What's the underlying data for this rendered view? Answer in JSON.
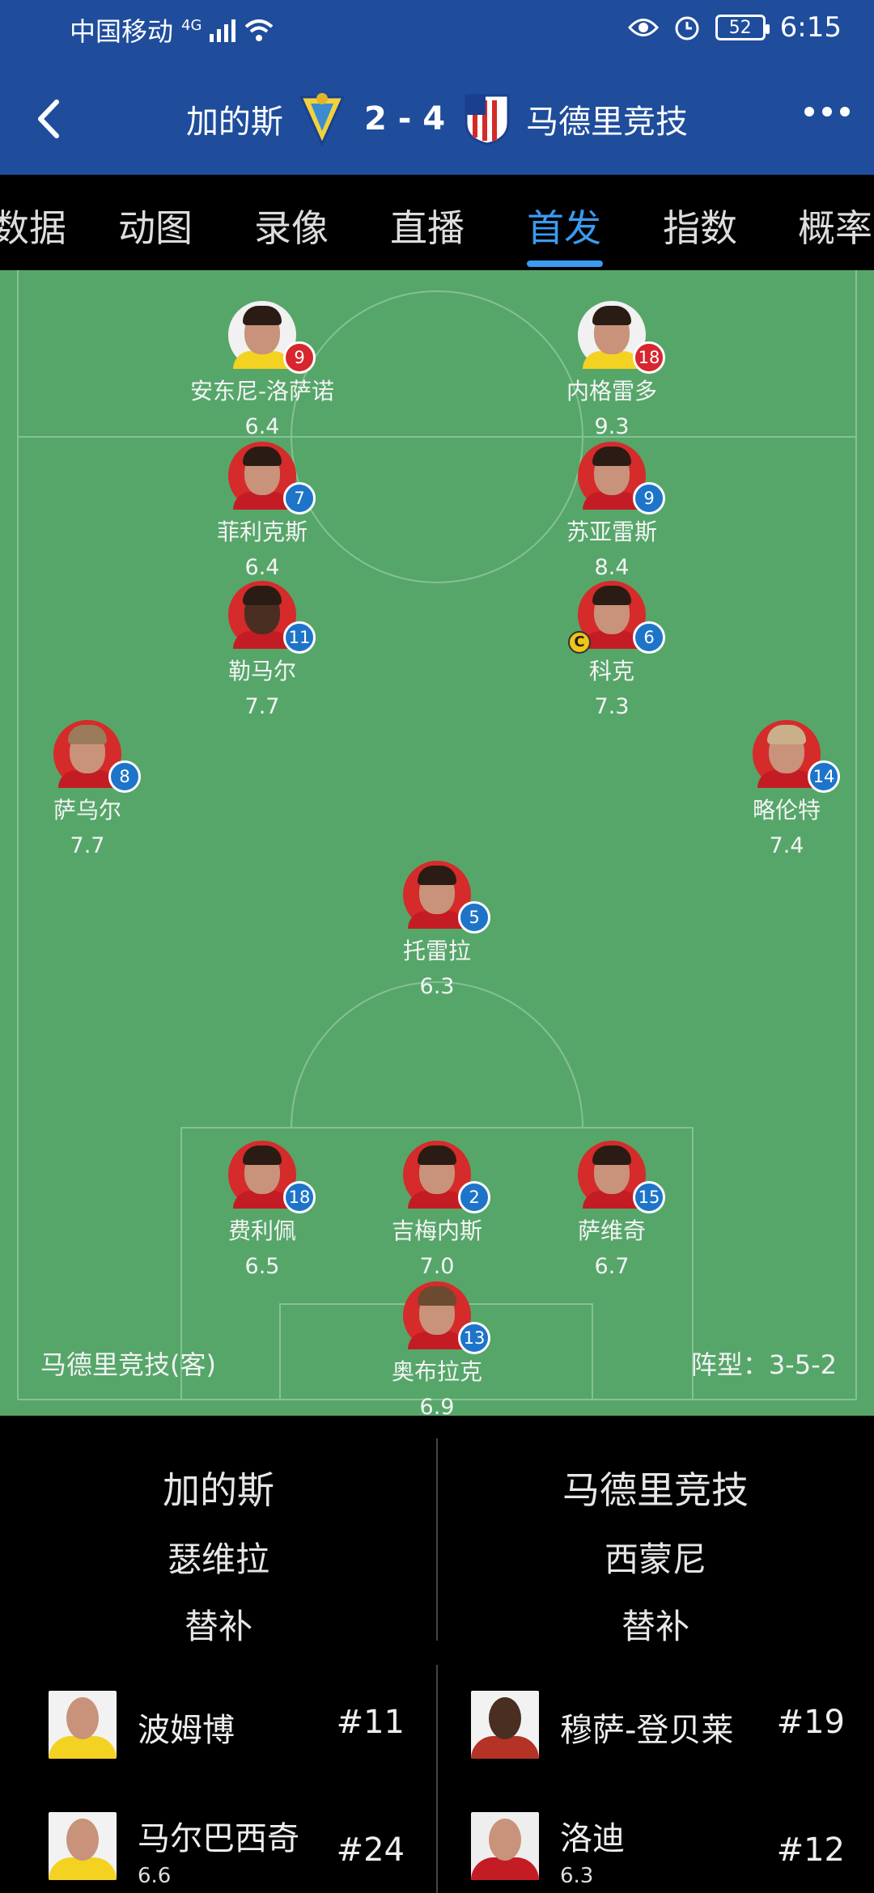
{
  "status_bar": {
    "carrier": "中国移动",
    "network": "4G",
    "battery": "52",
    "time": "6:15"
  },
  "header": {
    "home_team": "加的斯",
    "score": "2 - 4",
    "away_team": "马德里竞技"
  },
  "tabs": [
    {
      "label": "数据"
    },
    {
      "label": "动图"
    },
    {
      "label": "录像"
    },
    {
      "label": "直播"
    },
    {
      "label": "首发",
      "active": true
    },
    {
      "label": "指数"
    },
    {
      "label": "概率"
    }
  ],
  "pitch": {
    "team_label": "马德里竞技(客)",
    "formation": "阵型：3-5-2",
    "players": [
      {
        "name": "安东尼-洛萨诺",
        "rating": "6.4",
        "number": "9",
        "kit": "yellow",
        "badge": "red"
      },
      {
        "name": "内格雷多",
        "rating": "9.3",
        "number": "18",
        "kit": "yellow",
        "badge": "red"
      },
      {
        "name": "菲利克斯",
        "rating": "6.4",
        "number": "7",
        "kit": "red",
        "badge": "blue"
      },
      {
        "name": "苏亚雷斯",
        "rating": "8.4",
        "number": "9",
        "kit": "red",
        "badge": "blue"
      },
      {
        "name": "勒马尔",
        "rating": "7.7",
        "number": "11",
        "kit": "red",
        "badge": "blue"
      },
      {
        "name": "科克",
        "rating": "7.3",
        "number": "6",
        "kit": "red",
        "badge": "blue",
        "captain": "C"
      },
      {
        "name": "萨乌尔",
        "rating": "7.7",
        "number": "8",
        "kit": "red",
        "badge": "blue"
      },
      {
        "name": "略伦特",
        "rating": "7.4",
        "number": "14",
        "kit": "red",
        "badge": "blue"
      },
      {
        "name": "托雷拉",
        "rating": "6.3",
        "number": "5",
        "kit": "red",
        "badge": "blue"
      },
      {
        "name": "费利佩",
        "rating": "6.5",
        "number": "18",
        "kit": "red",
        "badge": "blue"
      },
      {
        "name": "吉梅内斯",
        "rating": "7.0",
        "number": "2",
        "kit": "red",
        "badge": "blue"
      },
      {
        "name": "萨维奇",
        "rating": "6.7",
        "number": "15",
        "kit": "red",
        "badge": "blue"
      },
      {
        "name": "奥布拉克",
        "rating": "6.9",
        "number": "13",
        "kit": "red",
        "badge": "blue"
      }
    ]
  },
  "bottom": {
    "home": {
      "team": "加的斯",
      "coach": "瑟维拉",
      "subs_label": "替补"
    },
    "away": {
      "team": "马德里竞技",
      "coach": "西蒙尼",
      "subs_label": "替补"
    },
    "home_subs": [
      {
        "name": "波姆博",
        "number": "#11",
        "rating": ""
      },
      {
        "name": "马尔巴西奇",
        "number": "#24",
        "rating": "6.6"
      }
    ],
    "away_subs": [
      {
        "name": "穆萨-登贝莱",
        "number": "#19",
        "rating": ""
      },
      {
        "name": "洛迪",
        "number": "#12",
        "rating": "6.3"
      }
    ]
  }
}
